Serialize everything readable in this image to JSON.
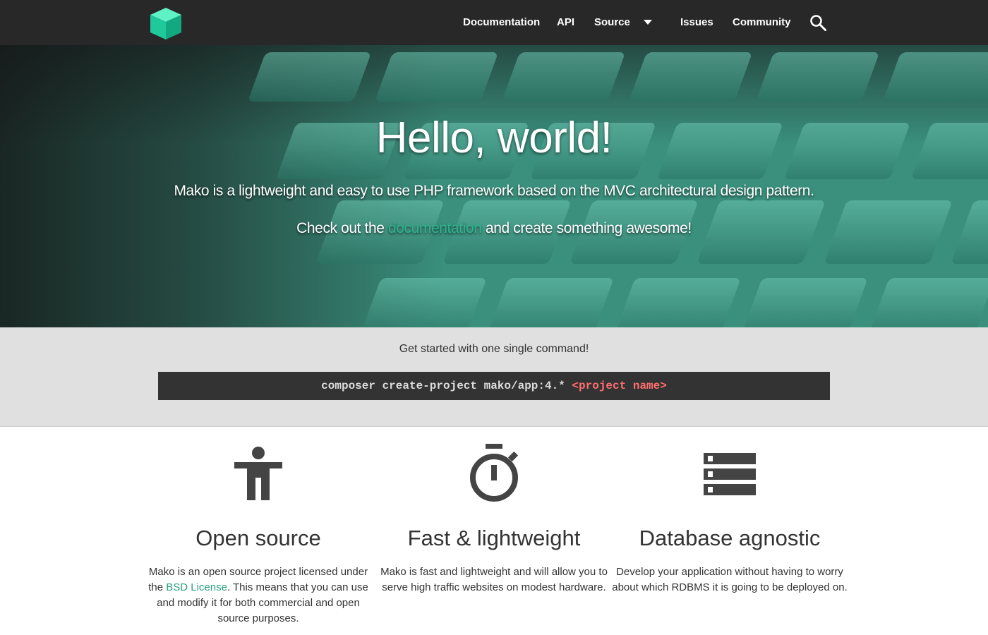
{
  "nav": {
    "logo_icon": "green-cube-icon",
    "items": [
      {
        "label": "Documentation"
      },
      {
        "label": "API"
      },
      {
        "label": "Source"
      },
      {
        "label": "Issues"
      },
      {
        "label": "Community"
      }
    ],
    "dropdown_icon": "caret-down-icon",
    "search_icon": "search-icon"
  },
  "hero": {
    "title": "Hello, world!",
    "tagline": "Mako is a lightweight and easy to use PHP framework based on the MVC architectural design pattern.",
    "cta_before": "Check out the ",
    "cta_link": "documentation",
    "cta_after": " and create something awesome!"
  },
  "get_started": {
    "heading": "Get started with one single command!",
    "command": "composer create-project mako/app:4.* ",
    "placeholder": "<project name>"
  },
  "features": [
    {
      "icon": "accessibility-person-icon",
      "title": "Open source",
      "text_before": "Mako is an open source project licensed under the ",
      "link": "BSD License",
      "text_after": ". This means that you can use and modify it for both commercial and open source purposes."
    },
    {
      "icon": "stopwatch-icon",
      "title": "Fast & lightweight",
      "text": "Mako is fast and lightweight and will allow you to serve high traffic websites on modest hardware."
    },
    {
      "icon": "database-storage-icon",
      "title": "Database agnostic",
      "text": "Develop your application without having to worry about which RDBMS it is going to be deployed on."
    }
  ],
  "colors": {
    "nav_bg": "#282828",
    "accent": "#2fb38f",
    "command_bg": "#333333",
    "command_placeholder": "#ff6e6e"
  }
}
